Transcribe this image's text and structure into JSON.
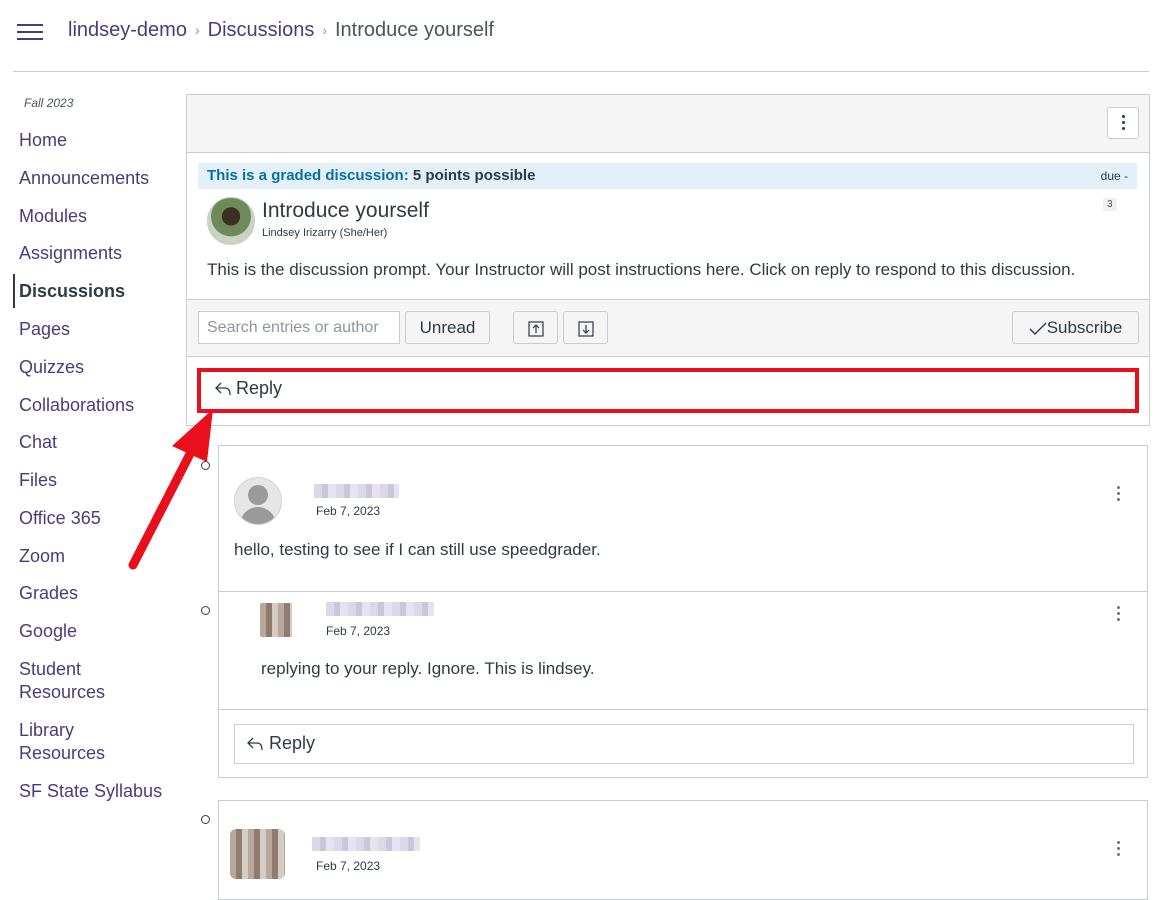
{
  "header": {
    "breadcrumbs": [
      "lindsey-demo",
      "Discussions",
      "Introduce yourself"
    ],
    "separator": "›"
  },
  "sidebar": {
    "term": "Fall 2023",
    "items": [
      {
        "label": "Home"
      },
      {
        "label": "Announcements"
      },
      {
        "label": "Modules"
      },
      {
        "label": "Assignments"
      },
      {
        "label": "Discussions",
        "active": true
      },
      {
        "label": "Pages"
      },
      {
        "label": "Quizzes"
      },
      {
        "label": "Collaborations"
      },
      {
        "label": "Chat"
      },
      {
        "label": "Files"
      },
      {
        "label": "Office 365"
      },
      {
        "label": "Zoom"
      },
      {
        "label": "Grades"
      },
      {
        "label": "Google"
      },
      {
        "label": "Student Resources"
      },
      {
        "label": "Library Resources"
      },
      {
        "label": "SF State Syllabus"
      }
    ]
  },
  "topic": {
    "graded_label": "This is a graded discussion:",
    "points": "5 points possible",
    "due": "due -",
    "title": "Introduce yourself",
    "author": "Lindsey Irizarry (She/Her)",
    "reply_count": "3",
    "prompt": "This is the discussion prompt. Your Instructor will post instructions here. Click on reply to respond to this discussion."
  },
  "toolbar": {
    "search_placeholder": "Search entries or author",
    "unread_label": "Unread",
    "subscribe_label": "Subscribe"
  },
  "reply_label": "Reply",
  "entries": [
    {
      "date": "Feb 7, 2023",
      "text": "hello, testing to see if I can still use speedgrader.",
      "replies": [
        {
          "date": "Feb 7, 2023",
          "text": "replying to your reply. Ignore. This is lindsey."
        }
      ],
      "reply_label": "Reply"
    },
    {
      "date": "Feb 7, 2023"
    }
  ],
  "colors": {
    "nav_link": "#4b3b7a",
    "graded_text": "#0770a3",
    "graded_bg": "#e3f0f8",
    "highlight": "#e8101a",
    "border": "#c7cdd1"
  }
}
